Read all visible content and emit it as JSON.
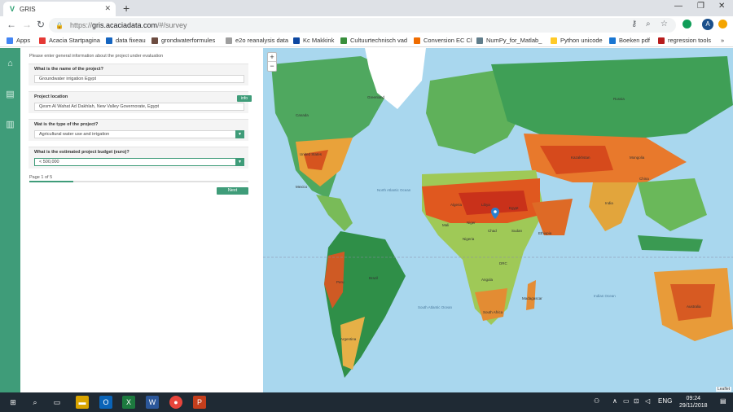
{
  "browser": {
    "tab_title": "GRIS",
    "tab_favicon": "V",
    "url_scheme": "https://",
    "url_host": "gris.acaciadata.com",
    "url_path": "/#/survey"
  },
  "bookmarks": [
    {
      "label": "Apps",
      "color": "#4285f4"
    },
    {
      "label": "Acacia Startpagina",
      "color": "#e53935"
    },
    {
      "label": "data fixeau",
      "color": "#1565c0"
    },
    {
      "label": "grondwaterformules",
      "color": "#6d4c41"
    },
    {
      "label": "e2o reanalysis data",
      "color": "#9e9e9e"
    },
    {
      "label": "Kc Makkink",
      "color": "#0d47a1"
    },
    {
      "label": "Cultuurtechnisch vad",
      "color": "#388e3c"
    },
    {
      "label": "Conversion EC Cl",
      "color": "#ef6c00"
    },
    {
      "label": "NumPy_for_Matlab_",
      "color": "#607d8b"
    },
    {
      "label": "Python unicode",
      "color": "#ffca28"
    },
    {
      "label": "Boeken pdf",
      "color": "#1976d2"
    },
    {
      "label": "regression tools",
      "color": "#b71c1c"
    }
  ],
  "survey": {
    "intro": "Please enter general information about the project under evaluation",
    "q1_label": "What is the name of the project?",
    "q1_value": "Groundwater irrigation Egypt",
    "q2_label": "Project location",
    "q2_value": "Qesm Al Wahat Ad Dakhlah, New Valley Governorate, Egypt",
    "info_label": "info",
    "q3_label": "Wat is the type of the project?",
    "q3_value": "Agricultural water use and irrigation",
    "q4_label": "What is the estimated project budget (euro)?",
    "q4_value": "< 500,000",
    "pager": "Page 1 of 5",
    "progress": 0.2,
    "next_label": "Next"
  },
  "map": {
    "zoom_in": "+",
    "zoom_out": "−",
    "attribution": "Leaflet",
    "labels": [
      "Greenland",
      "North Atlantic Ocean",
      "South Atlantic Ocean",
      "Indian Ocean",
      "Chad",
      "Sudan",
      "Egypt",
      "Kazakhstan",
      "Mongolia",
      "China",
      "India",
      "Australia",
      "Brazil",
      "Peru",
      "Russia",
      "Canada",
      "United States",
      "Mexico",
      "Algeria",
      "Libya",
      "Mali",
      "Niger",
      "Nigeria",
      "Ethiopia",
      "DRC",
      "Angola",
      "South Africa",
      "Madagascar",
      "Argentina"
    ]
  },
  "taskbar": {
    "time": "09:24",
    "date": "29/11/2018",
    "lang": "ENG"
  }
}
